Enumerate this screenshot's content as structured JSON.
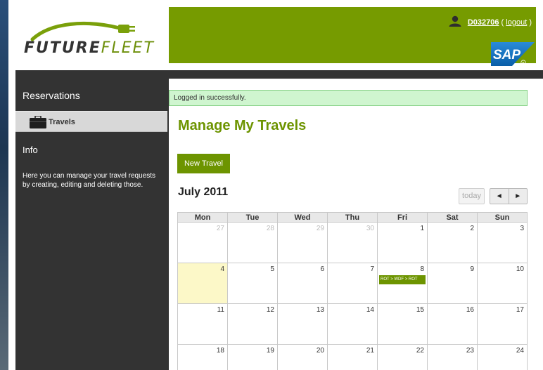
{
  "brand": {
    "logo_text_bold": "FUTURE",
    "logo_text_light": "FLEET",
    "sap_label": "SAP"
  },
  "header": {
    "username": "D032706",
    "logout_open": "(",
    "logout_label": "logout",
    "logout_close": ")"
  },
  "sidebar": {
    "reservations_label": "Reservations",
    "travels_label": "Travels",
    "info_label": "Info",
    "info_text": "Here you can manage your travel requests by creating, editing and deleting those."
  },
  "main": {
    "message": "Logged in successfully.",
    "title": "Manage My Travels",
    "new_travel_label": "New Travel"
  },
  "calendar": {
    "month_label": "July 2011",
    "today_label": "today",
    "prev_icon": "◄",
    "next_icon": "►",
    "weekdays": [
      "Mon",
      "Tue",
      "Wed",
      "Thu",
      "Fri",
      "Sat",
      "Sun"
    ],
    "weeks": [
      [
        {
          "d": "27",
          "other": true
        },
        {
          "d": "28",
          "other": true
        },
        {
          "d": "29",
          "other": true
        },
        {
          "d": "30",
          "other": true
        },
        {
          "d": "1"
        },
        {
          "d": "2"
        },
        {
          "d": "3"
        }
      ],
      [
        {
          "d": "4",
          "today": true
        },
        {
          "d": "5"
        },
        {
          "d": "6"
        },
        {
          "d": "7"
        },
        {
          "d": "8",
          "event": "ROT > WDF > ROT"
        },
        {
          "d": "9"
        },
        {
          "d": "10"
        }
      ],
      [
        {
          "d": "11"
        },
        {
          "d": "12"
        },
        {
          "d": "13"
        },
        {
          "d": "14"
        },
        {
          "d": "15"
        },
        {
          "d": "16"
        },
        {
          "d": "17"
        }
      ],
      [
        {
          "d": "18"
        },
        {
          "d": "19"
        },
        {
          "d": "20"
        },
        {
          "d": "21"
        },
        {
          "d": "22"
        },
        {
          "d": "23"
        },
        {
          "d": "24"
        }
      ]
    ]
  },
  "colors": {
    "brand_green": "#769b00",
    "dark_sidebar": "#333333",
    "success_bg": "#cff5cf",
    "today_bg": "#fcf8c8"
  }
}
